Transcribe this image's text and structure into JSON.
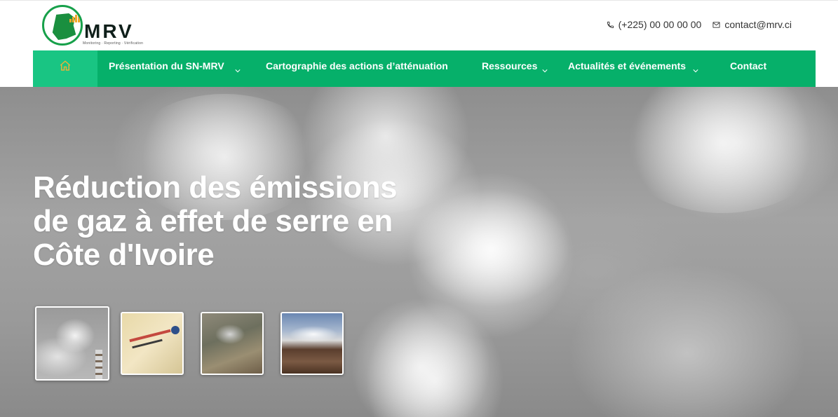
{
  "header": {
    "logo": {
      "word": "MRV",
      "tagline": "Monitoring · Reporting · Vérification"
    },
    "contact": {
      "phone": "(+225) 00 00 00 00",
      "email": "contact@mrv.ci"
    }
  },
  "nav": {
    "home_icon": "home-icon",
    "items": [
      {
        "label": "Présentation du SN-MRV",
        "has_dropdown": true
      },
      {
        "label": "Cartographie des actions d’atténuation",
        "has_dropdown": false
      },
      {
        "label": "Ressources",
        "has_dropdown": true
      },
      {
        "label": "Actualités et événements",
        "has_dropdown": true
      },
      {
        "label": "Contact",
        "has_dropdown": false
      }
    ]
  },
  "hero": {
    "title": "Réduction des émissions de gaz à effet de serre en Côte d'Ivoire",
    "thumbnails": [
      "smoke-stack",
      "map",
      "industrial-site",
      "geothermal-field"
    ]
  },
  "colors": {
    "nav_bg": "#06b06a",
    "nav_home_bg": "#19c583",
    "logo_green": "#17a04a",
    "logo_orange": "#f2a72a"
  }
}
